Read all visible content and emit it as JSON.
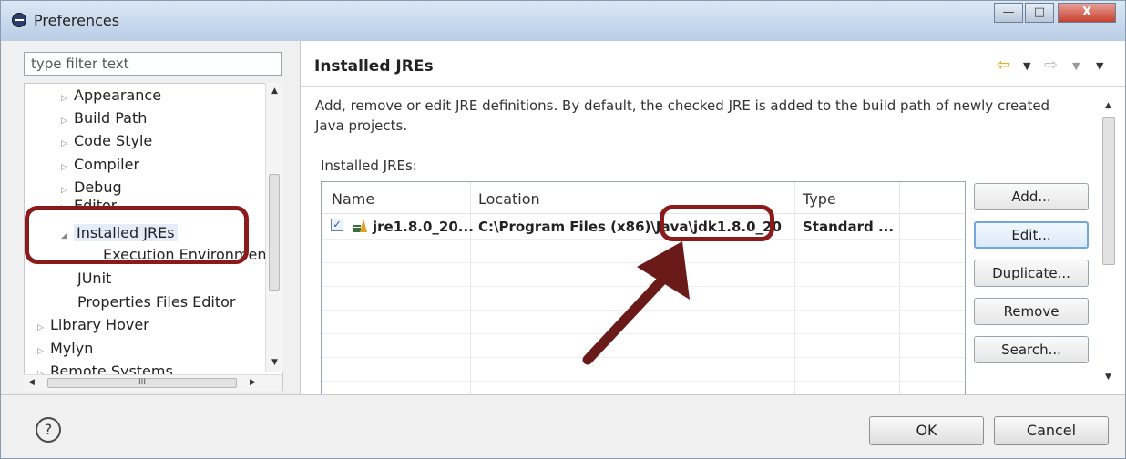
{
  "window": {
    "title": "Preferences",
    "min_glyph": "—",
    "max_glyph": "□",
    "close_glyph": "X"
  },
  "filter": {
    "placeholder": "type filter text"
  },
  "tree": {
    "items": [
      {
        "label": "Appearance"
      },
      {
        "label": "Build Path"
      },
      {
        "label": "Code Style"
      },
      {
        "label": "Compiler"
      },
      {
        "label": "Debug"
      },
      {
        "label": "Editor"
      },
      {
        "label": "Installed JREs"
      },
      {
        "label": "Execution Environments"
      },
      {
        "label": "JUnit"
      },
      {
        "label": "Properties Files Editor"
      },
      {
        "label": "Library Hover"
      },
      {
        "label": "Mylyn"
      },
      {
        "label": "Remote Systems"
      }
    ],
    "scroll_thumb_label": "III"
  },
  "page": {
    "title": "Installed JREs",
    "description": "Add, remove or edit JRE definitions. By default, the checked JRE is added to the build path of newly created Java projects.",
    "label": "Installed JREs:"
  },
  "table": {
    "columns": [
      "Name",
      "Location",
      "Type"
    ],
    "rows": [
      {
        "checked": true,
        "name": "jre1.8.0_20...",
        "location": "C:\\Program Files (x86)\\Java\\jdk1.8.0_20",
        "type": "Standard ..."
      }
    ]
  },
  "buttons": {
    "add": "Add...",
    "edit": "Edit...",
    "duplicate": "Duplicate...",
    "remove": "Remove",
    "search": "Search..."
  },
  "dialog": {
    "ok": "OK",
    "cancel": "Cancel",
    "help_glyph": "?"
  },
  "colors": {
    "annotation": "#8b1a1a",
    "accent": "#6fa8dc"
  }
}
